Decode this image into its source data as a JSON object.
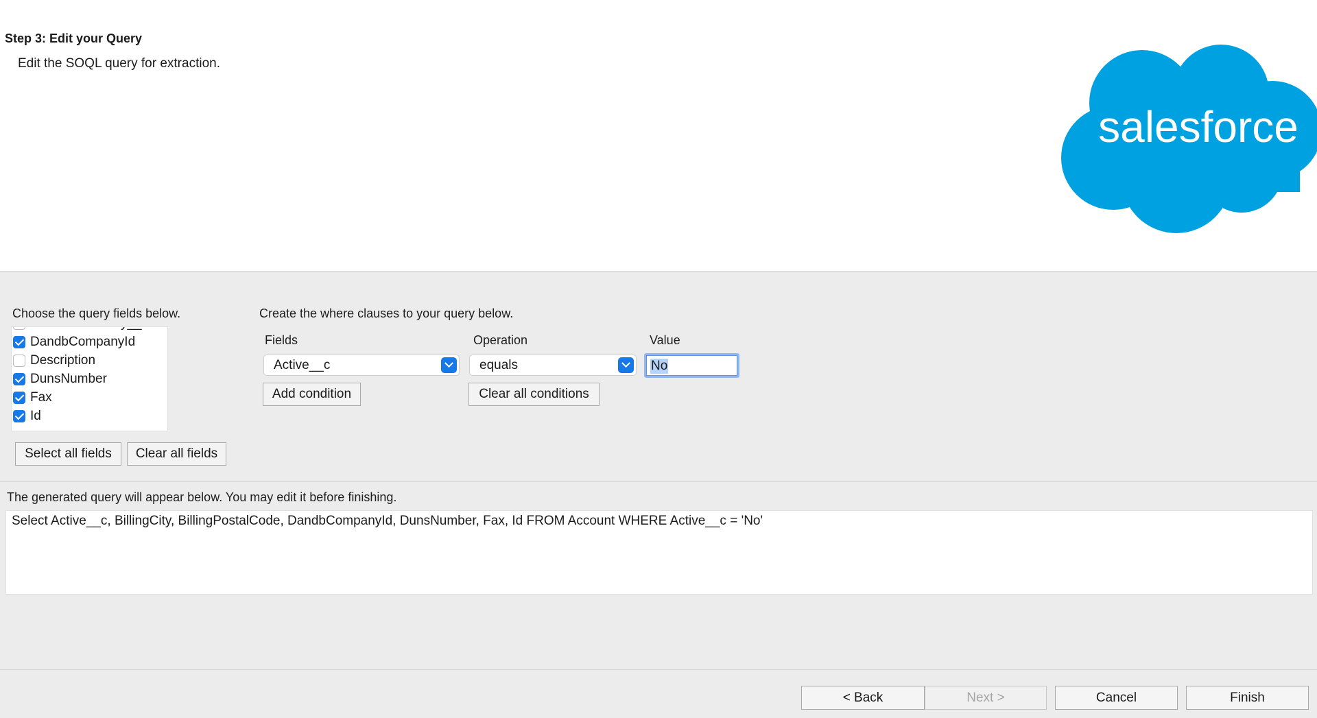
{
  "header": {
    "step_title": "Step 3: Edit your Query",
    "step_subtitle": "Edit the SOQL query for extraction.",
    "logo_text": "salesforce",
    "logo_color": "#00a1e0"
  },
  "fields_section": {
    "label": "Choose the query fields below.",
    "fields": [
      {
        "name": "CustomerPriority__c",
        "checked": false
      },
      {
        "name": "DandbCompanyId",
        "checked": true
      },
      {
        "name": "Description",
        "checked": false
      },
      {
        "name": "DunsNumber",
        "checked": true
      },
      {
        "name": "Fax",
        "checked": true
      },
      {
        "name": "Id",
        "checked": true
      }
    ],
    "select_all_label": "Select all fields",
    "clear_all_label": "Clear all fields"
  },
  "where_section": {
    "label": "Create the where clauses to your query below.",
    "fields_header": "Fields",
    "operation_header": "Operation",
    "value_header": "Value",
    "field_selected": "Active__c",
    "operation_selected": "equals",
    "value": "No",
    "add_condition_label": "Add condition",
    "clear_conditions_label": "Clear all conditions"
  },
  "query_section": {
    "label": "The generated query will appear below.  You may edit it before finishing.",
    "query": "Select Active__c, BillingCity, BillingPostalCode, DandbCompanyId, DunsNumber, Fax, Id FROM Account WHERE Active__c = 'No'"
  },
  "footer": {
    "back_label": "< Back",
    "next_label": "Next >",
    "cancel_label": "Cancel",
    "finish_label": "Finish"
  },
  "colors": {
    "accent": "#1778e8",
    "selection": "#b5d3fb"
  }
}
